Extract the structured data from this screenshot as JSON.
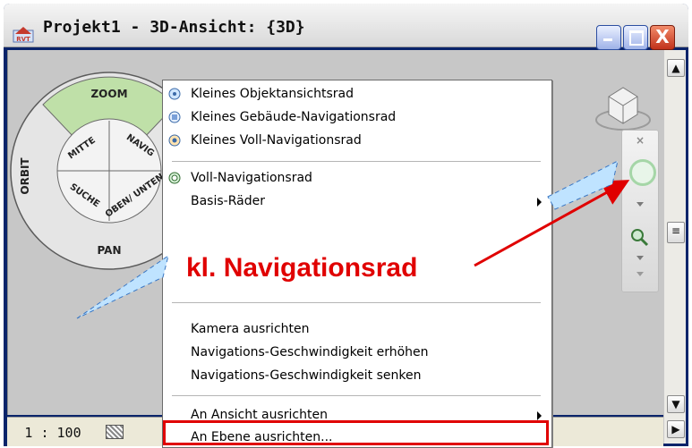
{
  "window": {
    "title": "Projekt1 - 3D-Ansicht: {3D}",
    "app_icon_text": "RVT",
    "buttons": {
      "minimize": "_",
      "maximize": "□",
      "close": "X"
    }
  },
  "status": {
    "scale": "1 : 100"
  },
  "nav_wheel": {
    "zoom": "ZOOM",
    "orbit": "ORBIT",
    "pan": "PAN",
    "mitte": "MITTE",
    "navigation": "NAVIG",
    "suche": "SUCHE",
    "oben_unten": "OBEN/ UNTEN"
  },
  "context_menu": {
    "items": [
      {
        "label": "Kleines Objektansichtsrad",
        "icon": "small-object-wheel-icon"
      },
      {
        "label": "Kleines Gebäude-Navigationsrad",
        "icon": "small-building-wheel-icon"
      },
      {
        "label": "Kleines Voll-Navigationsrad",
        "icon": "small-full-wheel-icon"
      },
      {
        "label": "Voll-Navigationsrad",
        "icon": "full-wheel-icon"
      },
      {
        "label": "Basis-Räder",
        "icon": ""
      },
      {
        "label": "Kamera ausrichten",
        "icon": ""
      },
      {
        "label": "Navigations-Geschwindigkeit erhöhen",
        "icon": ""
      },
      {
        "label": "Navigations-Geschwindigkeit senken",
        "icon": ""
      },
      {
        "label": "An Ansicht ausrichten",
        "icon": ""
      },
      {
        "label": "An Ebene ausrichten...",
        "icon": ""
      }
    ]
  },
  "callout": {
    "text": "kl. Navigationsrad"
  },
  "colors": {
    "callout": "#e00000",
    "viewport": "#c7c7c7",
    "accent": "#a5d6a7"
  }
}
